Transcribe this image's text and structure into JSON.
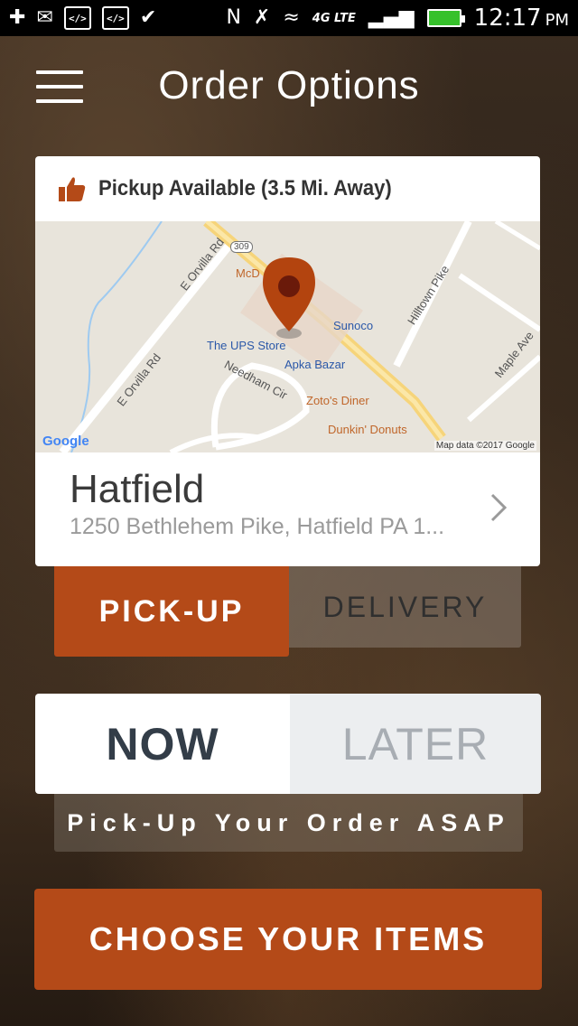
{
  "status_bar": {
    "time": "12:17",
    "ampm": "PM",
    "network": "4G LTE",
    "icons": [
      "add-icon",
      "gmail-icon",
      "code-icon",
      "code-icon",
      "check-icon",
      "nfc-icon",
      "mute-icon",
      "wifi-icon",
      "signal-icon",
      "battery-icon"
    ]
  },
  "header": {
    "title": "Order Options"
  },
  "location_card": {
    "pickup_text": "Pickup Available (3.5 Mi. Away)",
    "store_name": "Hatfield",
    "store_address": "1250 Bethlehem Pike, Hatfield PA 1...",
    "map": {
      "labels": {
        "orvilla_rd_1": "E Orvilla Rd",
        "orvilla_rd_2": "E Orvilla Rd",
        "route": "309",
        "mcdonalds": "McD",
        "hilltown": "Hilltown Pike",
        "sunoco": "Sunoco",
        "ups": "The UPS Store",
        "apka": "Apka Bazar",
        "needham": "Needham Cir",
        "maple": "Maple Ave",
        "zotos": "Zoto's Diner",
        "dunkin": "Dunkin' Donuts",
        "google": "Google",
        "map_data": "Map data ©2017 Google"
      }
    }
  },
  "fulfillment_tabs": {
    "pickup": "PICK-UP",
    "delivery": "DELIVERY",
    "selected": "pickup"
  },
  "timing": {
    "now": "NOW",
    "later": "LATER",
    "selected": "now",
    "caption": "Pick-Up Your Order ASAP"
  },
  "cta": {
    "label": "CHOOSE YOUR ITEMS"
  },
  "colors": {
    "accent": "#b44a18",
    "now_text": "#333d48"
  }
}
